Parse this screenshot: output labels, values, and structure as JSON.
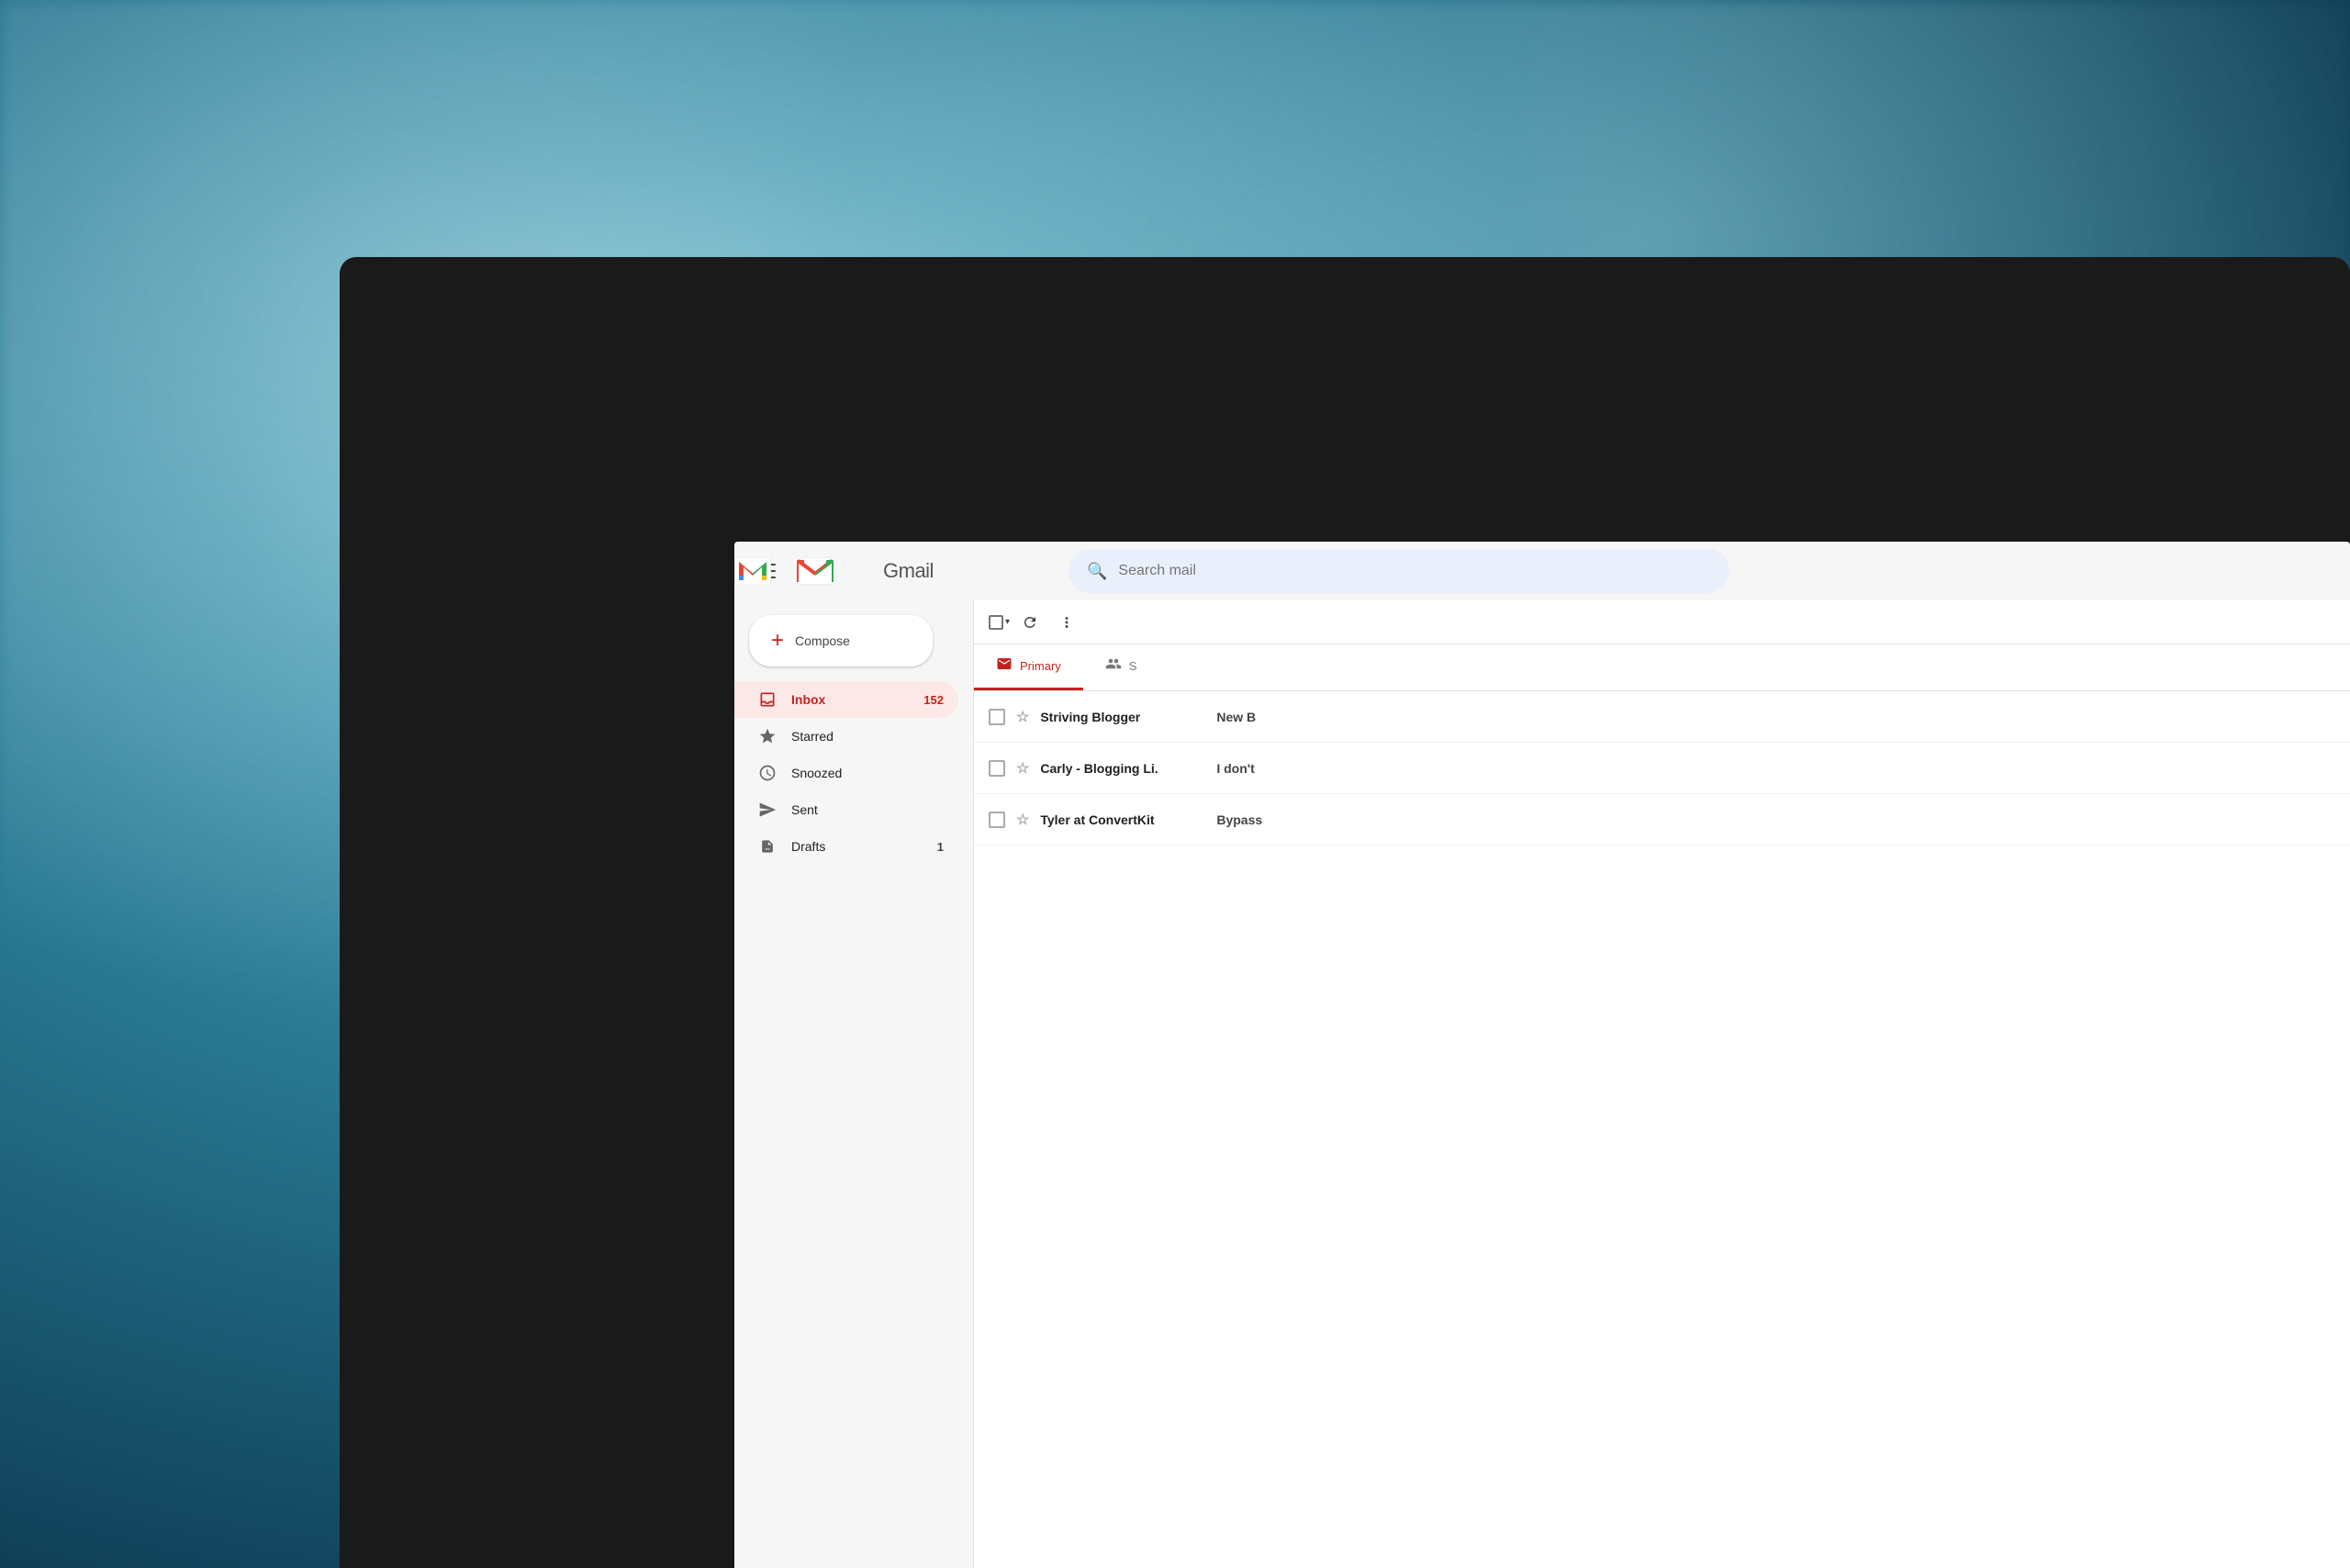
{
  "background": {
    "description": "blurred ocean water background"
  },
  "header": {
    "menu_label": "Main menu",
    "logo_text": "Gmail",
    "search_placeholder": "Search mail"
  },
  "sidebar": {
    "compose_label": "Compose",
    "nav_items": [
      {
        "id": "inbox",
        "label": "Inbox",
        "count": "152",
        "active": true
      },
      {
        "id": "starred",
        "label": "Starred",
        "count": "",
        "active": false
      },
      {
        "id": "snoozed",
        "label": "Snoozed",
        "count": "",
        "active": false
      },
      {
        "id": "sent",
        "label": "Sent",
        "count": "",
        "active": false
      },
      {
        "id": "drafts",
        "label": "Drafts",
        "count": "1",
        "active": false
      }
    ]
  },
  "toolbar": {
    "select_label": "Select",
    "refresh_label": "Refresh",
    "more_label": "More"
  },
  "tabs": [
    {
      "id": "primary",
      "label": "Primary",
      "active": true
    },
    {
      "id": "social",
      "label": "Social",
      "active": false
    }
  ],
  "emails": [
    {
      "sender": "Striving Blogger",
      "preview": "New B"
    },
    {
      "sender": "Carly - Blogging Li.",
      "preview": "I don't"
    },
    {
      "sender": "Tyler at ConvertKit",
      "preview": "Bypass"
    }
  ],
  "colors": {
    "accent_red": "#c5221f",
    "gmail_blue": "#4285f4",
    "gmail_red": "#ea4335",
    "gmail_yellow": "#fbbc05",
    "gmail_green": "#34a853"
  }
}
